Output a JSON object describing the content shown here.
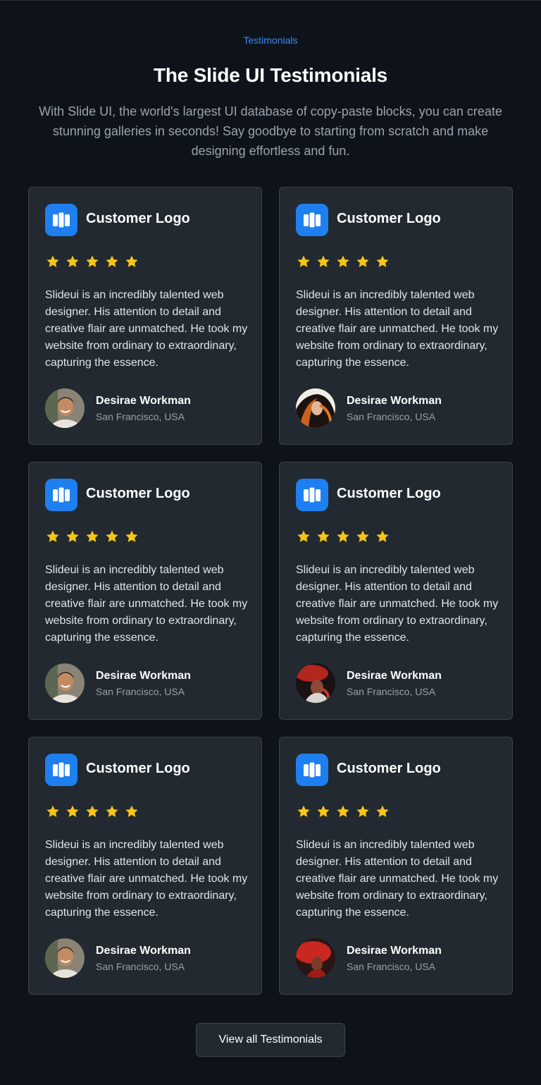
{
  "header": {
    "eyebrow": "Testimonials",
    "title": "The Slide UI Testimonials",
    "subtitle": "With Slide UI, the world's largest UI database of copy-paste blocks, you can create stunning galleries in seconds! Say goodbye to starting from scratch and make designing effortless and fun."
  },
  "colors": {
    "background": "#0e131b",
    "card": "#222930",
    "accent": "#3b8bf5",
    "logo": "#1e7ff0",
    "star": "#f5c518"
  },
  "testimonials": [
    {
      "logo_icon": "customer-logo-icon",
      "logo_label": "Customer Logo",
      "rating": 5,
      "quote": "Slideui is an incredibly talented web designer. His attention to detail and creative flair are unmatched. He took my website from ordinary to extraordinary, capturing the essence.",
      "name": "Desirae Workman",
      "location": "San Francisco, USA",
      "avatar": "smiling-man-avatar"
    },
    {
      "logo_icon": "customer-logo-icon",
      "logo_label": "Customer Logo",
      "rating": 5,
      "quote": "Slideui is an incredibly talented web designer. His attention to detail and creative flair are unmatched. He took my website from ordinary to extraordinary, capturing the essence.",
      "name": "Desirae Workman",
      "location": "San Francisco, USA",
      "avatar": "woman-flowing-hair-avatar"
    },
    {
      "logo_icon": "customer-logo-icon",
      "logo_label": "Customer Logo",
      "rating": 5,
      "quote": "Slideui is an incredibly talented web designer. His attention to detail and creative flair are unmatched. He took my website from ordinary to extraordinary, capturing the essence.",
      "name": "Desirae Workman",
      "location": "San Francisco, USA",
      "avatar": "smiling-man-avatar"
    },
    {
      "logo_icon": "customer-logo-icon",
      "logo_label": "Customer Logo",
      "rating": 5,
      "quote": "Slideui is an incredibly talented web designer. His attention to detail and creative flair are unmatched. He took my website from ordinary to extraordinary, capturing the essence.",
      "name": "Desirae Workman",
      "location": "San Francisco, USA",
      "avatar": "woman-red-hat-avatar"
    },
    {
      "logo_icon": "customer-logo-icon",
      "logo_label": "Customer Logo",
      "rating": 5,
      "quote": "Slideui is an incredibly talented web designer. His attention to detail and creative flair are unmatched. He took my website from ordinary to extraordinary, capturing the essence.",
      "name": "Desirae Workman",
      "location": "San Francisco, USA",
      "avatar": "smiling-man-avatar"
    },
    {
      "logo_icon": "customer-logo-icon",
      "logo_label": "Customer Logo",
      "rating": 5,
      "quote": "Slideui is an incredibly talented web designer. His attention to detail and creative flair are unmatched. He took my website from ordinary to extraordinary, capturing the essence.",
      "name": "Desirae Workman",
      "location": "San Francisco, USA",
      "avatar": "woman-red-hat-avatar"
    }
  ],
  "cta": {
    "label": "View all Testimonials"
  }
}
